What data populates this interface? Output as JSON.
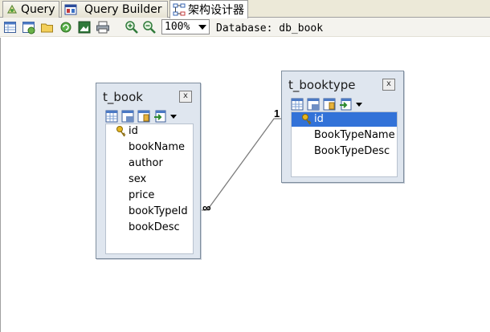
{
  "tabs": [
    {
      "label": "Query",
      "icon": "query-icon",
      "active": false
    },
    {
      "label": "Query Builder",
      "icon": "query-builder-icon",
      "active": false
    },
    {
      "label": "架构设计器",
      "icon": "schema-designer-icon",
      "active": true
    }
  ],
  "toolbar": {
    "buttons": [
      "add-table-icon",
      "add-view-icon",
      "open-folder-icon",
      "refresh-icon",
      "export-image-icon",
      "print-icon",
      "zoom-in-icon",
      "zoom-out-icon"
    ],
    "zoom_value": "100%",
    "database_label": "Database: db_book"
  },
  "relation": {
    "one_label": "1",
    "many_label": "∞"
  },
  "tables": [
    {
      "name": "t_book",
      "close_label": "x",
      "fields": [
        "id",
        "bookName",
        "author",
        "sex",
        "price",
        "bookTypeId",
        "bookDesc"
      ],
      "primary_key": "id"
    },
    {
      "name": "t_booktype",
      "close_label": "x",
      "fields": [
        "id",
        "BookTypeName",
        "BookTypeDesc"
      ],
      "primary_key": "id",
      "selected_field": "id"
    }
  ],
  "colors": {
    "selection": "#3272d8",
    "box_background": "#dfe6ef",
    "box_border": "#7f8e9e"
  }
}
